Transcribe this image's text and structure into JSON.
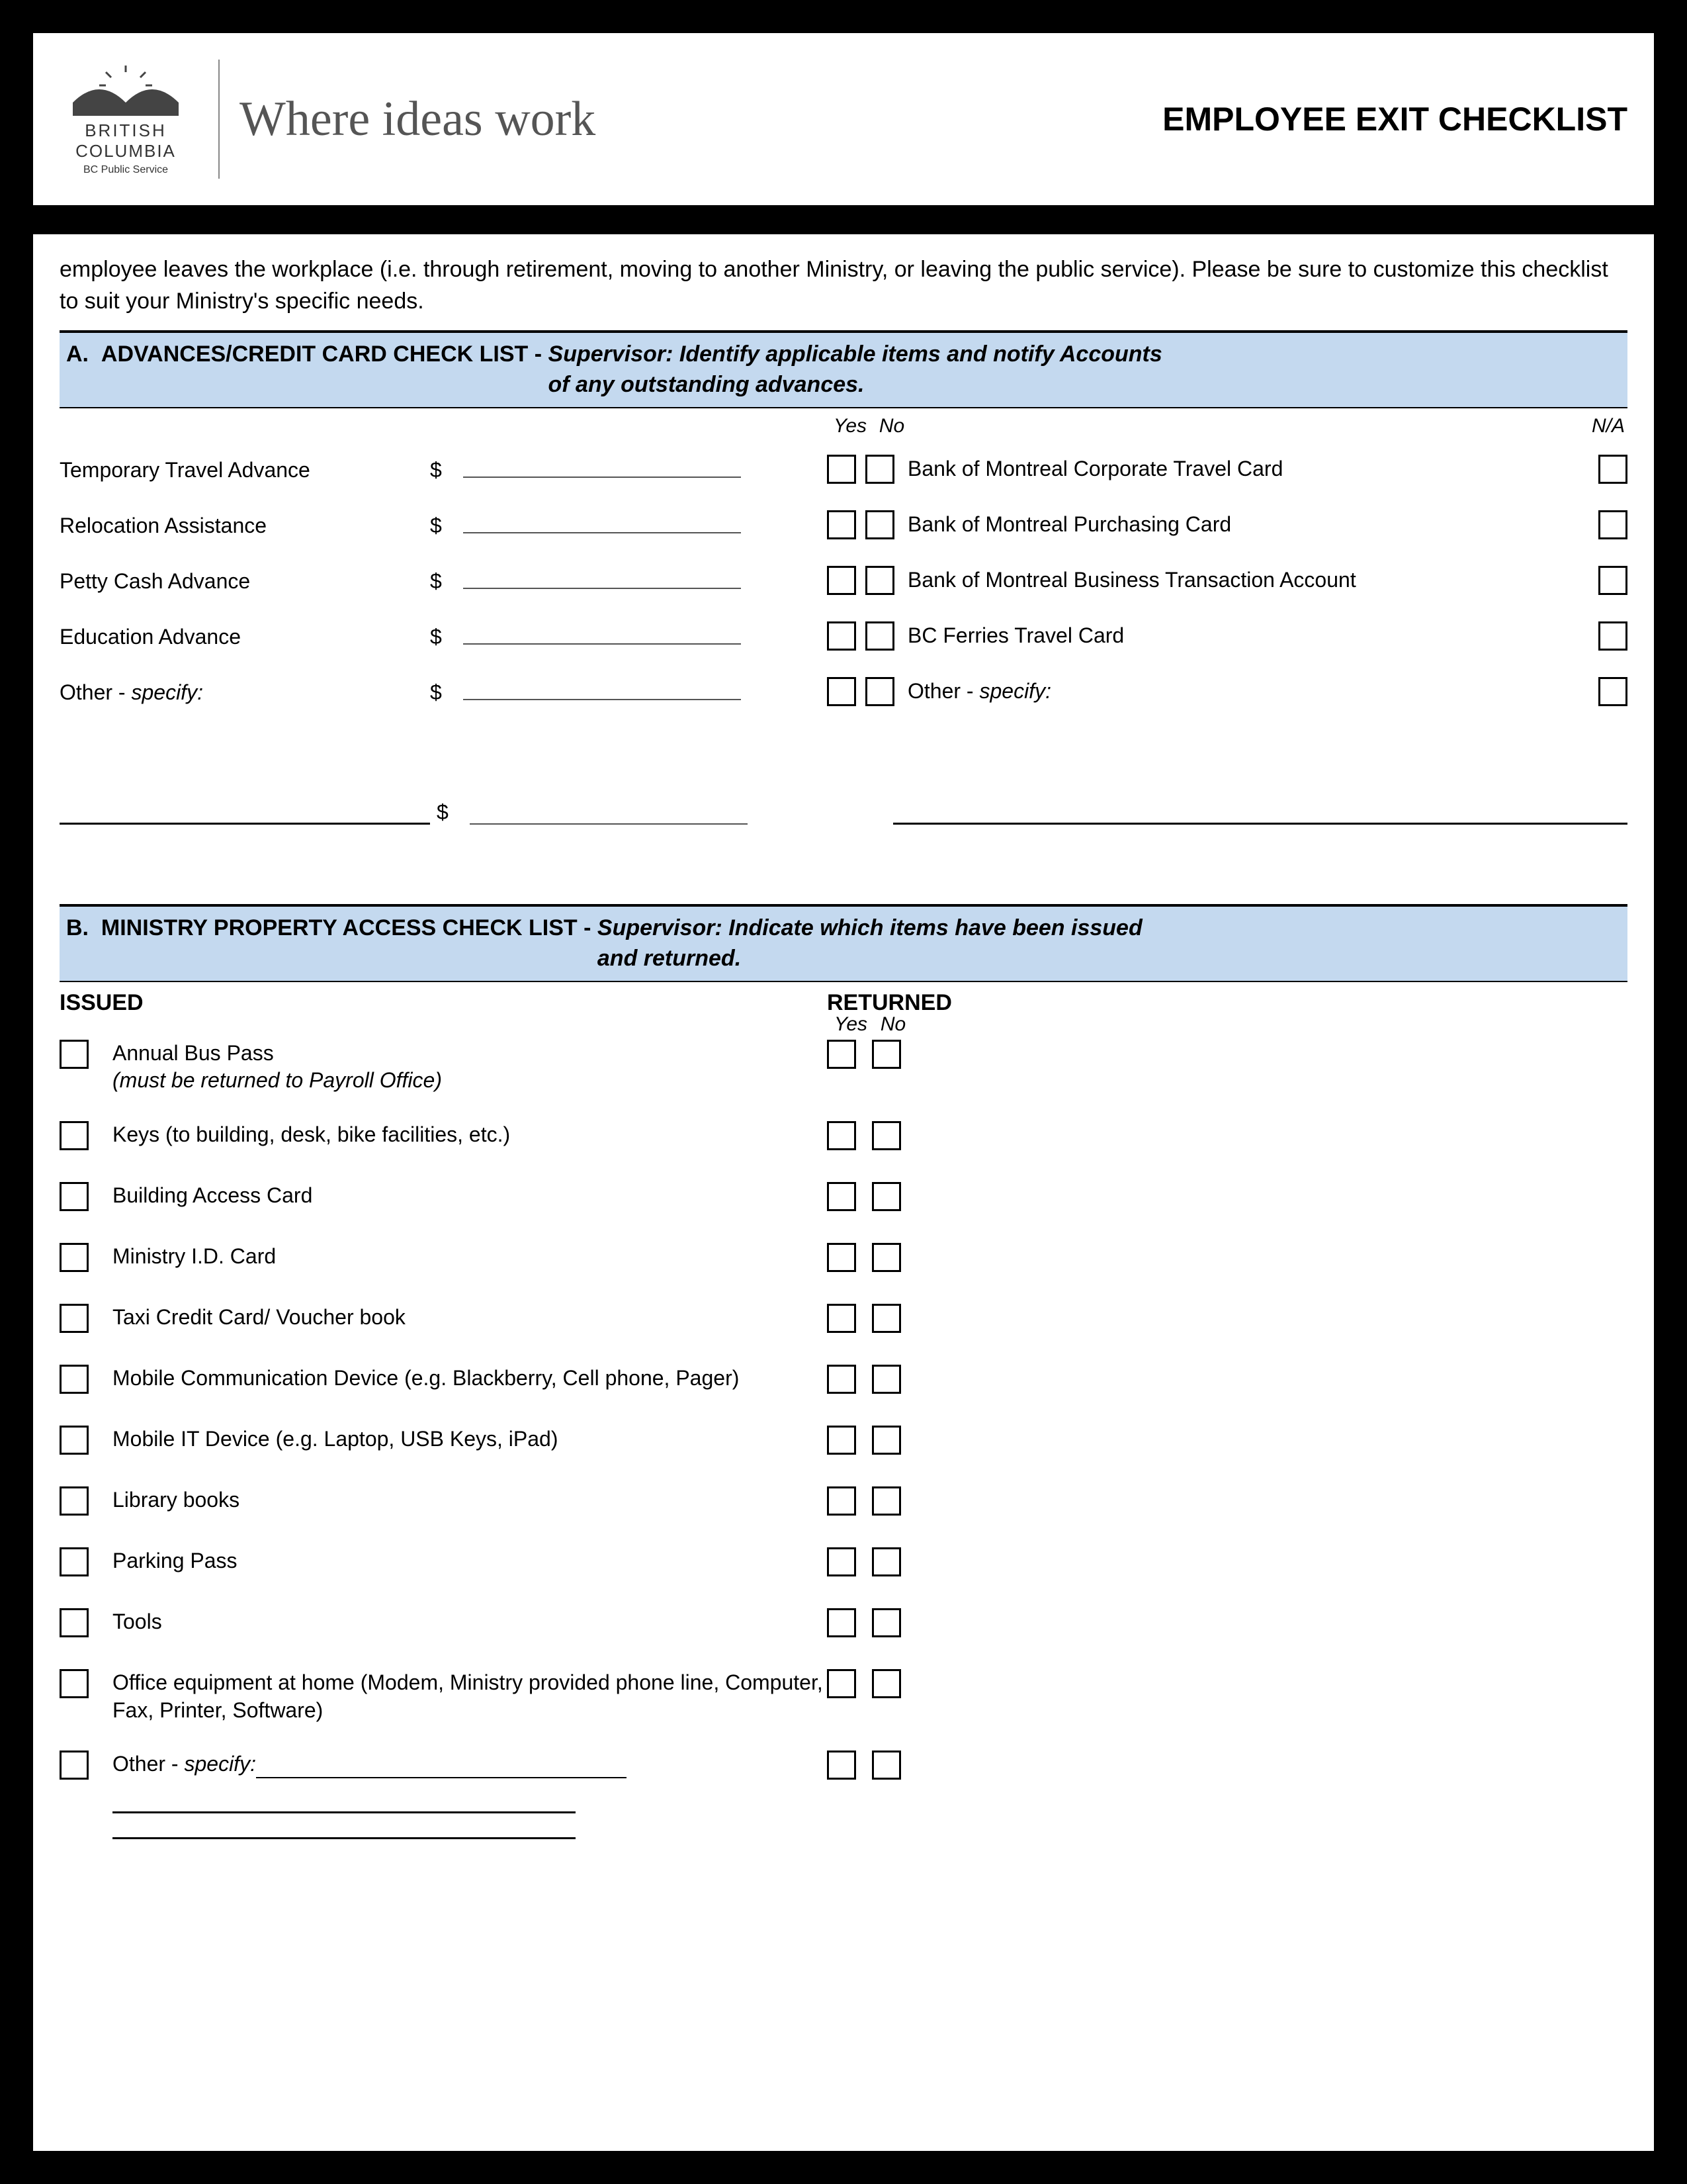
{
  "logo": {
    "line1": "BRITISH",
    "line2": "COLUMBIA",
    "line3": "BC Public Service"
  },
  "tagline": "Where ideas work",
  "title": "EMPLOYEE EXIT CHECKLIST",
  "intro": "employee leaves the workplace (i.e. through retirement, moving to another Ministry, or leaving the public service).  Please be sure to customize this checklist to suit your Ministry's specific needs.",
  "sectionA": {
    "letter": "A.",
    "title": "ADVANCES/CREDIT CARD CHECK LIST -",
    "instr1": "Supervisor:  Identify applicable items and notify Accounts",
    "instr2": "of any outstanding advances.",
    "yes": "Yes",
    "no": "No",
    "na": "N/A",
    "dollar": "$",
    "rowsLeft": [
      {
        "label": "Temporary Travel Advance"
      },
      {
        "label": "Relocation Assistance"
      },
      {
        "label": "Petty Cash Advance"
      },
      {
        "label": "Education Advance"
      },
      {
        "label": "Other - ",
        "italic_suffix": "specify:"
      }
    ],
    "rowsRight": [
      {
        "label": "Bank of Montreal Corporate Travel Card"
      },
      {
        "label": "Bank of Montreal Purchasing Card"
      },
      {
        "label": "Bank of Montreal Business Transaction Account"
      },
      {
        "label": "BC Ferries Travel Card"
      },
      {
        "label": "Other - ",
        "italic_suffix": "specify:"
      }
    ]
  },
  "sectionB": {
    "letter": "B.",
    "title": "MINISTRY PROPERTY ACCESS CHECK LIST -",
    "instr1": "Supervisor:  Indicate which items have been issued",
    "instr2": "and returned.",
    "issued": "ISSUED",
    "returned": "RETURNED",
    "yes": "Yes",
    "no": "No",
    "rows": [
      {
        "label": "Annual Bus Pass",
        "sub": "(must be returned to Payroll Office)"
      },
      {
        "label": "Keys (to building, desk, bike facilities, etc.)"
      },
      {
        "label": "Building Access Card"
      },
      {
        "label": "Ministry I.D. Card"
      },
      {
        "label": "Taxi Credit Card/ Voucher book"
      },
      {
        "label": "Mobile Communication Device (e.g. Blackberry, Cell phone, Pager)"
      },
      {
        "label": "Mobile IT Device (e.g. Laptop, USB Keys, iPad)"
      },
      {
        "label": "Library books"
      },
      {
        "label": "Parking Pass"
      },
      {
        "label": "Tools"
      },
      {
        "label": "Office equipment at home (Modem, Ministry provided phone line, Computer, Fax, Printer, Software)"
      },
      {
        "label": "Other - ",
        "italic_suffix": "specify:",
        "has_line": true
      }
    ]
  }
}
